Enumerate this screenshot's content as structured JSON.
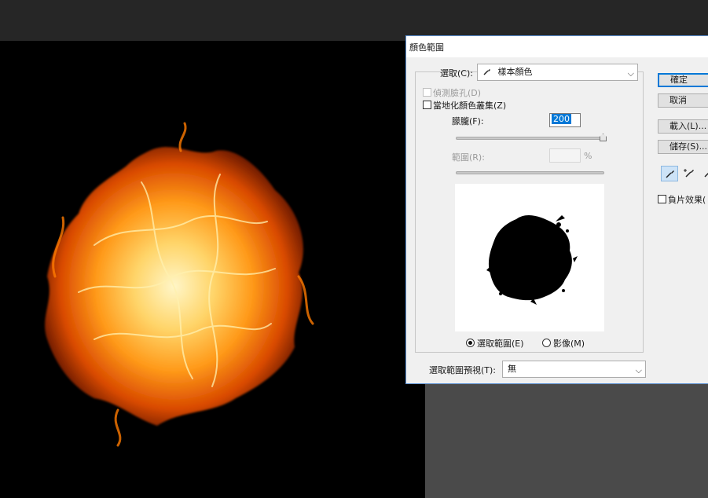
{
  "dialog": {
    "title": "顏色範圍",
    "select_label": "選取(C):",
    "select_icon": "eyedropper-icon",
    "select_value": "樣本顏色",
    "detect_faces_label": "偵測臉孔(D)",
    "localized_clusters_label": "當地化顏色叢集(Z)",
    "fuzziness_label": "朦朧(F):",
    "fuzziness_value": "200",
    "fuzziness_level": 1.0,
    "range_label": "範圍(R):",
    "range_value": "",
    "range_unit": "%",
    "view_selection_label": "選取範圍(E)",
    "view_image_label": "影像(M)",
    "view_selected": "selection",
    "preview_mode_label": "選取範圍預視(T):",
    "preview_mode_value": "無",
    "invert_label": "負片效果(",
    "invert_checked": false,
    "buttons": {
      "ok": "確定",
      "cancel": "取消",
      "load": "載入(L)...",
      "save": "儲存(S)..."
    },
    "tools": [
      "eyedropper-icon",
      "eyedropper-plus-icon",
      "eyedropper-minus-icon"
    ]
  },
  "colors": {
    "workspace": "#262626",
    "canvas": "#000000",
    "dialog_border": "#5b8fd0",
    "selection_highlight": "#0078d7"
  }
}
